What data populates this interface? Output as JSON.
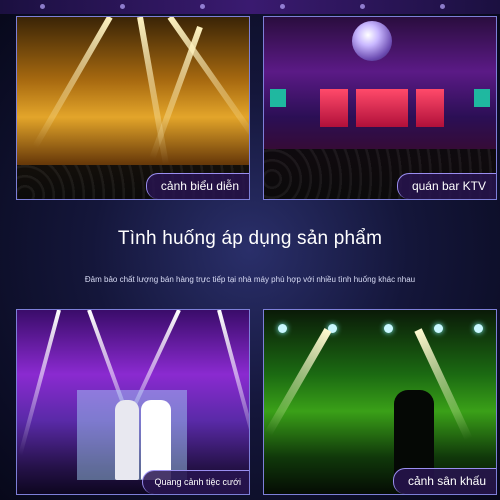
{
  "panels": {
    "top_left": {
      "label": "cảnh biểu diễn"
    },
    "top_right": {
      "label": "quán bar KTV"
    },
    "bottom_left": {
      "label": "Quang cảnh tiệc cưới"
    },
    "bottom_right": {
      "label": "cảnh sân khấu"
    }
  },
  "heading": "Tình huống áp dụng sản phẩm",
  "subheading": "Đảm bảo chất lượng bán hàng trực tiếp tại nhà máy phù hợp với nhiều tình huống khác nhau"
}
